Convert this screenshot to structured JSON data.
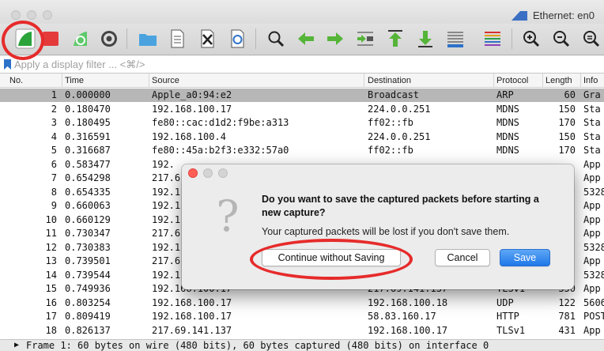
{
  "window": {
    "title": "Ethernet: en0",
    "traffic_light_color": "#d6d6d6"
  },
  "toolbar": {
    "buttons": [
      {
        "name": "start-capture",
        "icon": "shark-fin-icon"
      },
      {
        "name": "stop-capture",
        "icon": "stop-square-icon"
      },
      {
        "name": "restart-capture",
        "icon": "restart-fin-icon"
      },
      {
        "name": "capture-options",
        "icon": "gear-icon"
      },
      {
        "name": "open-file",
        "icon": "folder-icon"
      },
      {
        "name": "save-file",
        "icon": "file-icon"
      },
      {
        "name": "close-file",
        "icon": "close-file-icon"
      },
      {
        "name": "reload-file",
        "icon": "reload-icon"
      },
      {
        "name": "find-packet",
        "icon": "magnifier-icon"
      },
      {
        "name": "go-back",
        "icon": "arrow-left-icon"
      },
      {
        "name": "go-forward",
        "icon": "arrow-right-icon"
      },
      {
        "name": "go-to-packet",
        "icon": "go-to-packet-icon"
      },
      {
        "name": "first-packet",
        "icon": "arrow-up-bar-icon"
      },
      {
        "name": "last-packet",
        "icon": "arrow-down-bar-icon"
      },
      {
        "name": "autoscroll",
        "icon": "autoscroll-icon"
      },
      {
        "name": "colorize",
        "icon": "colorize-lines-icon"
      },
      {
        "name": "zoom-in",
        "icon": "zoom-in-icon"
      },
      {
        "name": "zoom-out",
        "icon": "zoom-out-icon"
      },
      {
        "name": "zoom-normal",
        "icon": "zoom-normal-icon"
      }
    ]
  },
  "filter": {
    "placeholder": "Apply a display filter ... <⌘/>"
  },
  "packet_list": {
    "columns": [
      "No.",
      "Time",
      "Source",
      "Destination",
      "Protocol",
      "Length",
      "Info"
    ],
    "rows": [
      {
        "no": "1",
        "time": "0.000000",
        "src": "Apple_a0:94:e2",
        "dst": "Broadcast",
        "proto": "ARP",
        "len": "60",
        "info": "Gra"
      },
      {
        "no": "2",
        "time": "0.180470",
        "src": "192.168.100.17",
        "dst": "224.0.0.251",
        "proto": "MDNS",
        "len": "150",
        "info": "Sta"
      },
      {
        "no": "3",
        "time": "0.180495",
        "src": "fe80::cac:d1d2:f9be:a313",
        "dst": "ff02::fb",
        "proto": "MDNS",
        "len": "170",
        "info": "Sta"
      },
      {
        "no": "4",
        "time": "0.316591",
        "src": "192.168.100.4",
        "dst": "224.0.0.251",
        "proto": "MDNS",
        "len": "150",
        "info": "Sta"
      },
      {
        "no": "5",
        "time": "0.316687",
        "src": "fe80::45a:b2f3:e332:57a0",
        "dst": "ff02::fb",
        "proto": "MDNS",
        "len": "170",
        "info": "Sta"
      },
      {
        "no": "6",
        "time": "0.583477",
        "src": "192.",
        "dst": "",
        "proto": "",
        "len": "",
        "info": "App"
      },
      {
        "no": "7",
        "time": "0.654298",
        "src": "217.6",
        "dst": "",
        "proto": "",
        "len": "",
        "info": "App"
      },
      {
        "no": "8",
        "time": "0.654335",
        "src": "192.1",
        "dst": "",
        "proto": "",
        "len": "",
        "info": "5328"
      },
      {
        "no": "9",
        "time": "0.660063",
        "src": "192.1",
        "dst": "",
        "proto": "",
        "len": "",
        "info": "App"
      },
      {
        "no": "10",
        "time": "0.660129",
        "src": "192.1",
        "dst": "",
        "proto": "",
        "len": "",
        "info": "App"
      },
      {
        "no": "11",
        "time": "0.730347",
        "src": "217.6",
        "dst": "",
        "proto": "",
        "len": "",
        "info": "App"
      },
      {
        "no": "12",
        "time": "0.730383",
        "src": "192.1",
        "dst": "",
        "proto": "",
        "len": "",
        "info": "5328"
      },
      {
        "no": "13",
        "time": "0.739501",
        "src": "217.6",
        "dst": "",
        "proto": "",
        "len": "",
        "info": "App"
      },
      {
        "no": "14",
        "time": "0.739544",
        "src": "192.1",
        "dst": "",
        "proto": "",
        "len": "",
        "info": "5328"
      },
      {
        "no": "15",
        "time": "0.749936",
        "src": "192.168.100.17",
        "dst": "217.69.141.137",
        "proto": "TLSv1",
        "len": "330",
        "info": "App"
      },
      {
        "no": "16",
        "time": "0.803254",
        "src": "192.168.100.17",
        "dst": "192.168.100.18",
        "proto": "UDP",
        "len": "122",
        "info": "5606"
      },
      {
        "no": "17",
        "time": "0.809419",
        "src": "192.168.100.17",
        "dst": "58.83.160.17",
        "proto": "HTTP",
        "len": "781",
        "info": "POST"
      },
      {
        "no": "18",
        "time": "0.826137",
        "src": "217.69.141.137",
        "dst": "192.168.100.17",
        "proto": "TLSv1",
        "len": "431",
        "info": "App"
      }
    ]
  },
  "status": {
    "text": "Frame 1: 60 bytes on wire (480 bits), 60 bytes captured (480 bits) on interface 0"
  },
  "dialog": {
    "icon": "question-mark-icon",
    "title": "Do you want to save the captured packets before starting a new capture?",
    "message": "Your captured packets will be lost if you don't save them.",
    "continue_label": "Continue without Saving",
    "cancel_label": "Cancel",
    "save_label": "Save",
    "accent": "#1f77e8"
  },
  "annotation_color": "#e62b2b"
}
